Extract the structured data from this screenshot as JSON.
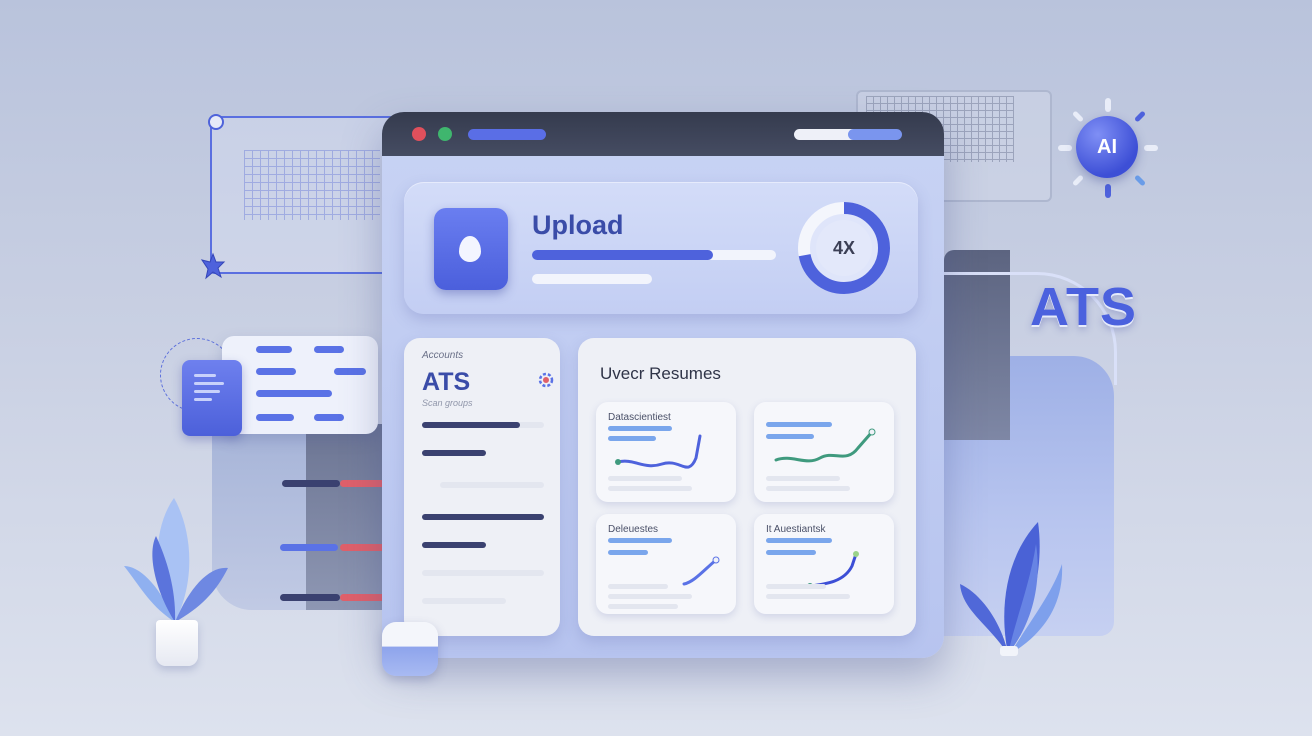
{
  "window": {
    "upload_title": "Upload",
    "upload_progress": 0.74,
    "gauge_label": "4X",
    "gauge_value": 0.72
  },
  "left_card": {
    "top_label": "Accounts",
    "title": "ATS",
    "subtitle": "Scan groups"
  },
  "right_card": {
    "title": "Uvecr Resumes",
    "minis": [
      {
        "title": "Datascientiest"
      },
      {
        "title": ""
      },
      {
        "title": "Deleuestes"
      },
      {
        "title": "It Auestiantsk"
      }
    ]
  },
  "badges": {
    "ai": "AI",
    "ats_big": "ATS"
  },
  "colors": {
    "accent": "#4e62dc",
    "accent_light": "#6a9ce8",
    "green_line": "#3f9a7e",
    "red_slider": "#e0606a",
    "dark_bar": "#3a4170"
  },
  "icons": [
    "upload-drop-icon",
    "gear-icon",
    "document-icon",
    "cursor-icon",
    "ai-sun-icon"
  ]
}
